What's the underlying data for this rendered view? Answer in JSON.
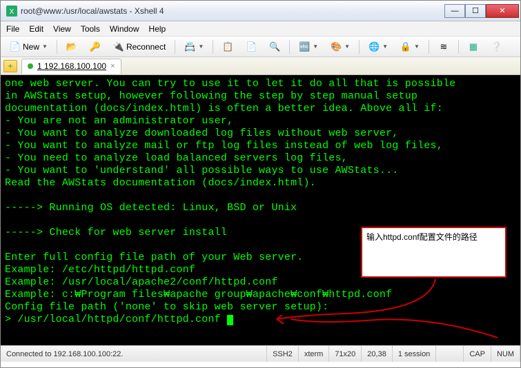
{
  "window": {
    "title": "root@www:/usr/local/awstats - Xshell 4"
  },
  "menu": {
    "file": "File",
    "edit": "Edit",
    "view": "View",
    "tools": "Tools",
    "window": "Window",
    "help": "Help"
  },
  "toolbar": {
    "new": "New",
    "reconnect": "Reconnect"
  },
  "tab": {
    "label": "1 192.168.100.100"
  },
  "terminal": {
    "lines": [
      "one web server. You can try to use it to let it do all that is possible",
      "in AWStats setup, however following the step by step manual setup",
      "documentation (docs/index.html) is often a better idea. Above all if:",
      "- You are not an administrator user,",
      "- You want to analyze downloaded log files without web server,",
      "- You want to analyze mail or ftp log files instead of web log files,",
      "- You need to analyze load balanced servers log files,",
      "- You want to 'understand' all possible ways to use AWStats...",
      "Read the AWStats documentation (docs/index.html).",
      "",
      "-----> Running OS detected: Linux, BSD or Unix",
      "",
      "-----> Check for web server install",
      "",
      "Enter full config file path of your Web server.",
      "Example: /etc/httpd/httpd.conf",
      "Example: /usr/local/apache2/conf/httpd.conf",
      "Example: c:\\Program files\\apache group\\apache\\conf\\httpd.conf",
      "Config file path ('none' to skip web server setup):"
    ],
    "prompt": "> /usr/local/httpd/conf/httpd.conf "
  },
  "status": {
    "connected": "Connected to 192.168.100.100:22.",
    "protocol": "SSH2",
    "term": "xterm",
    "size": "71x20",
    "cursor": "20,38",
    "session": "1 session",
    "cap": "CAP",
    "num": "NUM"
  },
  "annotation": {
    "text": "输入httpd.conf配置文件的路径"
  }
}
